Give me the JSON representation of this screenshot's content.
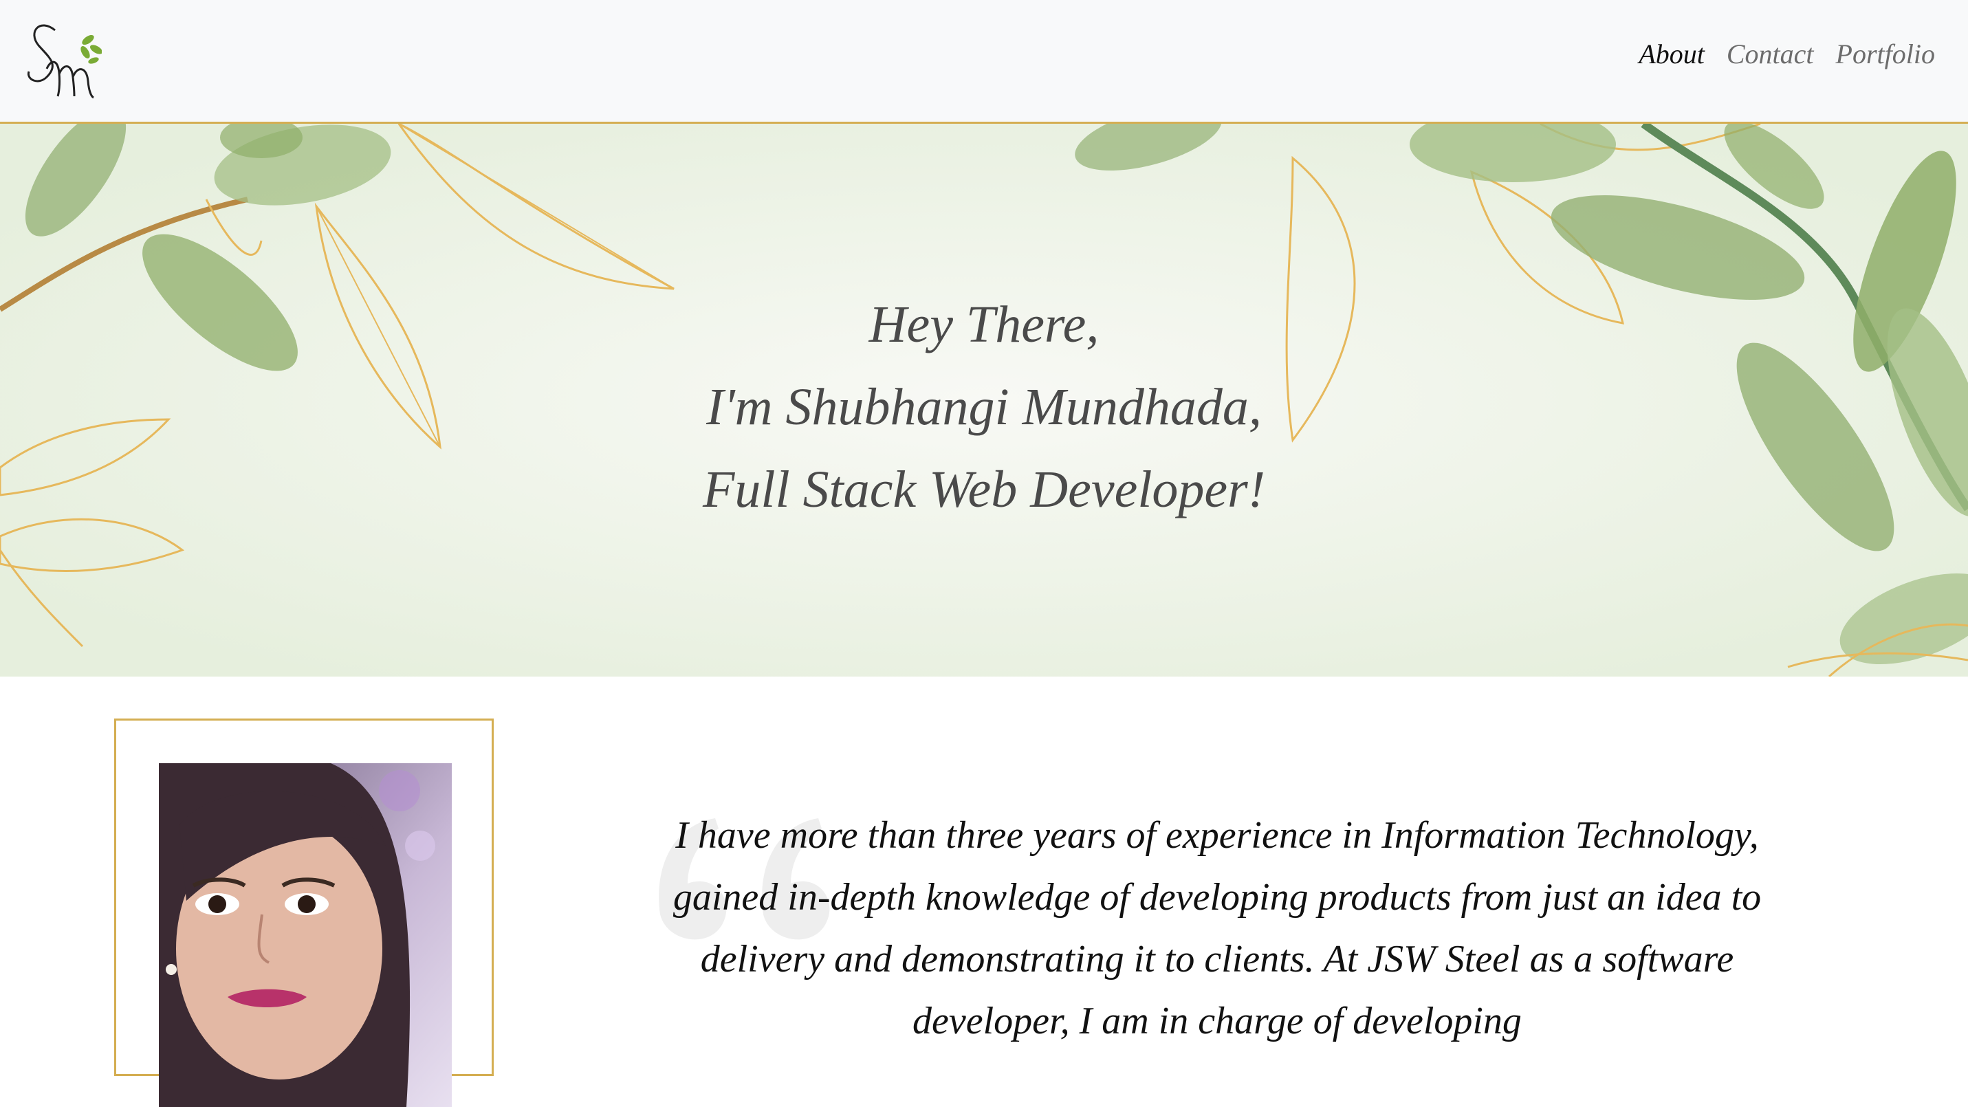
{
  "nav": {
    "logo_alt": "SM",
    "links": [
      {
        "label": "About",
        "active": true
      },
      {
        "label": "Contact",
        "active": false
      },
      {
        "label": "Portfolio",
        "active": false
      }
    ]
  },
  "hero": {
    "line1": "Hey There,",
    "line2": "I'm Shubhangi Mundhada,",
    "line3": "Full Stack Web Developer!"
  },
  "about": {
    "photo_icon": "profile-photo",
    "quote_icon": "quote-icon",
    "text": "I have more than three years of experience in Information Technology, gained in-depth knowledge of developing products from just an idea to delivery and demonstrating it to clients. At JSW Steel as a software developer, I am in charge of developing"
  },
  "colors": {
    "accent": "#d4ae52",
    "nav_bg": "#f8f9fa",
    "leaf_green": "#8fae6a",
    "text_dark": "#111111",
    "text_muted": "#6c6c6c"
  }
}
